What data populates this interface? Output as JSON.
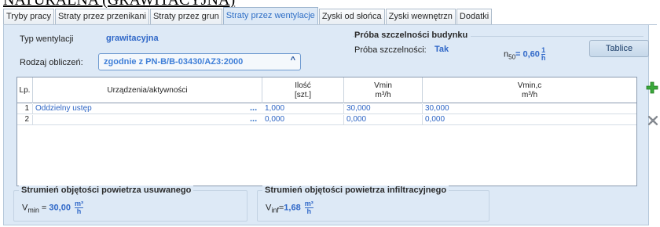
{
  "heading": "NATURALNA (GRAWITACYJNA)",
  "tabs": [
    {
      "label": "Tryby pracy"
    },
    {
      "label": "Straty przez przenikani"
    },
    {
      "label": "Straty przez grun"
    },
    {
      "label": "Straty przez wentylacje"
    },
    {
      "label": "Zyski od słońca"
    },
    {
      "label": "Zyski wewnętrzn"
    },
    {
      "label": "Dodatki"
    }
  ],
  "ventilation": {
    "type_label": "Typ wentylacji",
    "type_value": "grawitacyjna",
    "calc_label": "Rodzaj obliczeń:",
    "calc_value": "zgodnie z PN-B/B-03430/AZ3:2000"
  },
  "tightness": {
    "title": "Próba szczelności budynku",
    "label": "Próba szczelności:",
    "value": "Tak",
    "n50_prefix": "n",
    "n50_sub": "50",
    "n50_eq": "= 0,60",
    "n50_num": "1",
    "n50_den": "h",
    "button": "Tablice"
  },
  "table": {
    "columns": [
      {
        "line1": "Lp.",
        "line2": ""
      },
      {
        "line1": "Urządzenia/aktywności",
        "line2": ""
      },
      {
        "line1": "Ilość",
        "line2": "[szt.]"
      },
      {
        "line1": "Vmin",
        "line2": "m³/h"
      },
      {
        "line1": "Vmin,c",
        "line2": "m³/h"
      }
    ],
    "rows": [
      {
        "lp": "1",
        "name": "Oddzielny ustęp",
        "dots": "...",
        "qty": "1,000",
        "vmin": "30,000",
        "vminc": "30,000"
      },
      {
        "lp": "2",
        "name": "",
        "dots": "...",
        "qty": "0,000",
        "vmin": "0,000",
        "vminc": "0,000"
      }
    ]
  },
  "summary": {
    "exhaust": {
      "title": "Strumień objętości powietrza usuwanego",
      "symbol": "V",
      "sub": "min",
      "eq": "=",
      "value": "30,00",
      "unit_num": "m³",
      "unit_den": "h"
    },
    "infiltration": {
      "title": "Strumień objętości powietrza infiltracyjnego",
      "symbol": "V",
      "sub": "inf",
      "eq": "=",
      "value": "1,68",
      "unit_num": "m³",
      "unit_den": "h"
    }
  },
  "colors": {
    "accent": "#3068c8",
    "panel_bg": "#dde9f6",
    "add_icon": "#3aa83a",
    "delete_icon": "#8a8f96"
  },
  "icons": {
    "add": "plus-icon",
    "delete": "x-delete-icon"
  }
}
